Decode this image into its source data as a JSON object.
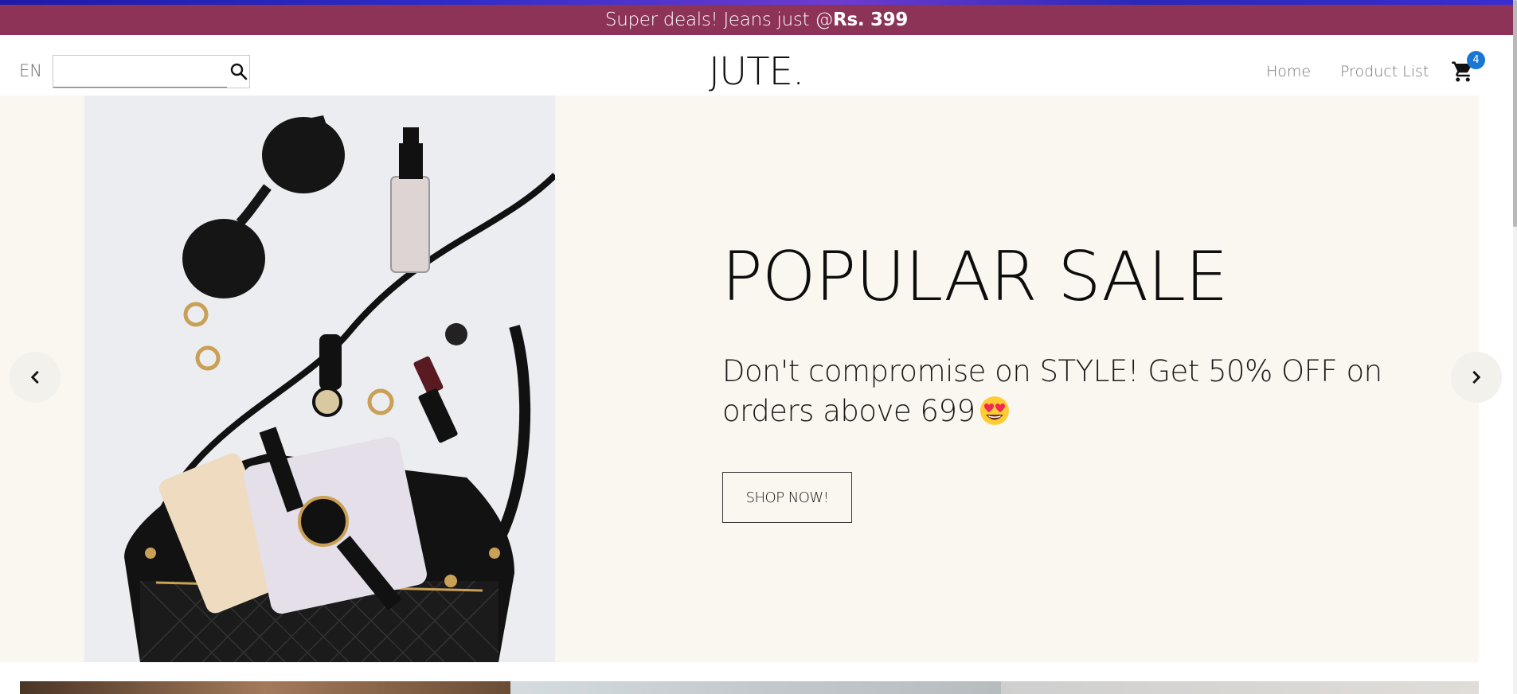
{
  "announcement": {
    "text": "Super deals! Jeans just @",
    "highlight": "Rs. 399"
  },
  "header": {
    "language": "EN",
    "search": {
      "value": "",
      "placeholder": ""
    },
    "logo": "JUTE.",
    "nav": [
      {
        "label": "Home"
      },
      {
        "label": "Product List"
      }
    ],
    "cart_count": "4"
  },
  "hero": {
    "title": "POPULAR SALE",
    "subtitle": "Don't compromise on STYLE! Get 50% OFF on orders above 699",
    "cta_label": "SHOP NOW!",
    "emoji": "heart-eyes-emoji"
  },
  "icons": {
    "search": "search-icon",
    "cart": "cart-icon",
    "prev": "chevron-left-icon",
    "next": "chevron-right-icon"
  },
  "colors": {
    "announcement_bg": "#8c3357",
    "hero_bg": "#faf7f0",
    "badge": "#1976d2"
  }
}
